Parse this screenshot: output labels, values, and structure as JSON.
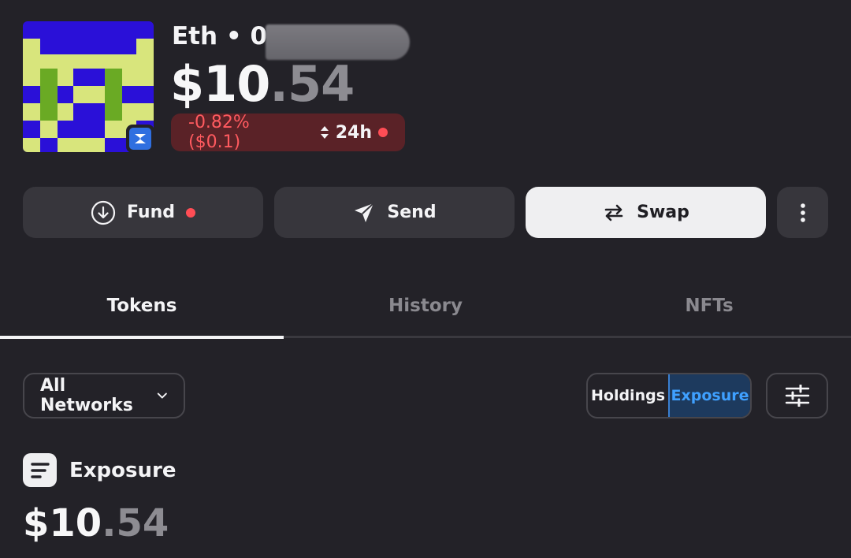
{
  "wallet": {
    "name": "Eth • 0x",
    "balance_whole": "$10",
    "balance_cents": ".54",
    "change": "-0.82% ($0.1)",
    "period": "24h"
  },
  "actions": {
    "fund": "Fund",
    "send": "Send",
    "swap": "Swap"
  },
  "tabs": [
    "Tokens",
    "History",
    "NFTs"
  ],
  "filters": {
    "network": "All Networks",
    "holdings": "Holdings",
    "exposure": "Exposure"
  },
  "section": {
    "title": "Exposure",
    "balance_whole": "$10",
    "balance_cents": ".54"
  },
  "colors": {
    "background": "#232228",
    "negative": "#ff5a5f",
    "accent": "#3fa0ff"
  },
  "icons": [
    "chain-badge-icon",
    "arrow-down-circle-icon",
    "paper-plane-icon",
    "swap-arrows-icon",
    "more-vertical-icon",
    "chevron-down-icon",
    "sliders-icon",
    "exposure-doc-icon"
  ]
}
